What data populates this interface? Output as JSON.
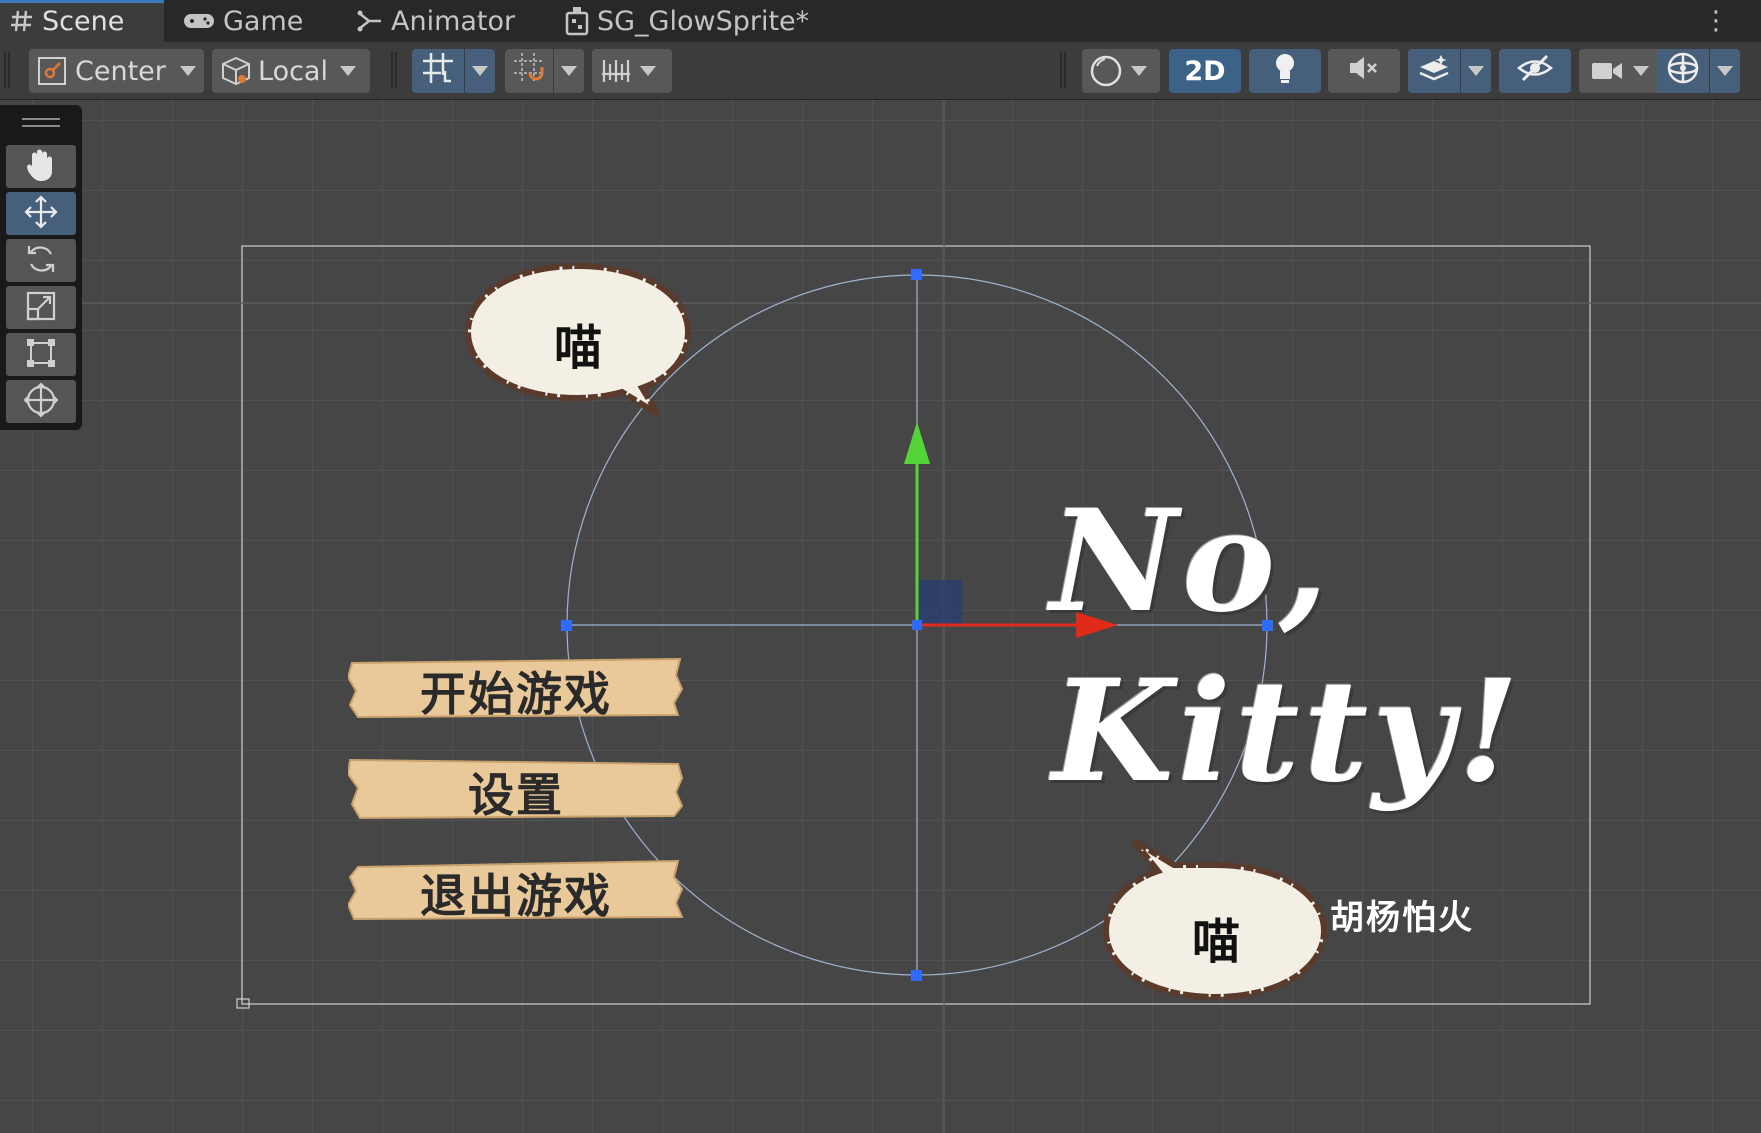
{
  "tabs": [
    {
      "label": "Scene",
      "icon": "grid-icon",
      "active": true
    },
    {
      "label": "Game",
      "icon": "gamepad-icon",
      "active": false
    },
    {
      "label": "Animator",
      "icon": "animator-icon",
      "active": false
    },
    {
      "label": "SG_GlowSprite*",
      "icon": "shader-graph-icon",
      "active": false
    }
  ],
  "toolbar": {
    "pivot_label": "Center",
    "space_label": "Local",
    "mode_2d_label": "2D"
  },
  "tools": [
    "hand-tool",
    "move-tool",
    "rotate-tool",
    "scale-tool",
    "rect-tool",
    "transform-tool"
  ],
  "selected_tool": "move-tool",
  "scene": {
    "bubble_top": "喵",
    "bubble_bottom": "喵",
    "menu": [
      "开始游戏",
      "设置",
      "退出游戏"
    ],
    "title_line1": "No,",
    "title_line2": "Kitty!",
    "author": "胡杨怕火"
  },
  "colors": {
    "accent": "#3a79bb",
    "axis_x": "#e02a1a",
    "axis_y": "#55d43a",
    "handle": "#2f6bff",
    "plank": "#e9c99a",
    "bubble": "#f4efe4"
  }
}
